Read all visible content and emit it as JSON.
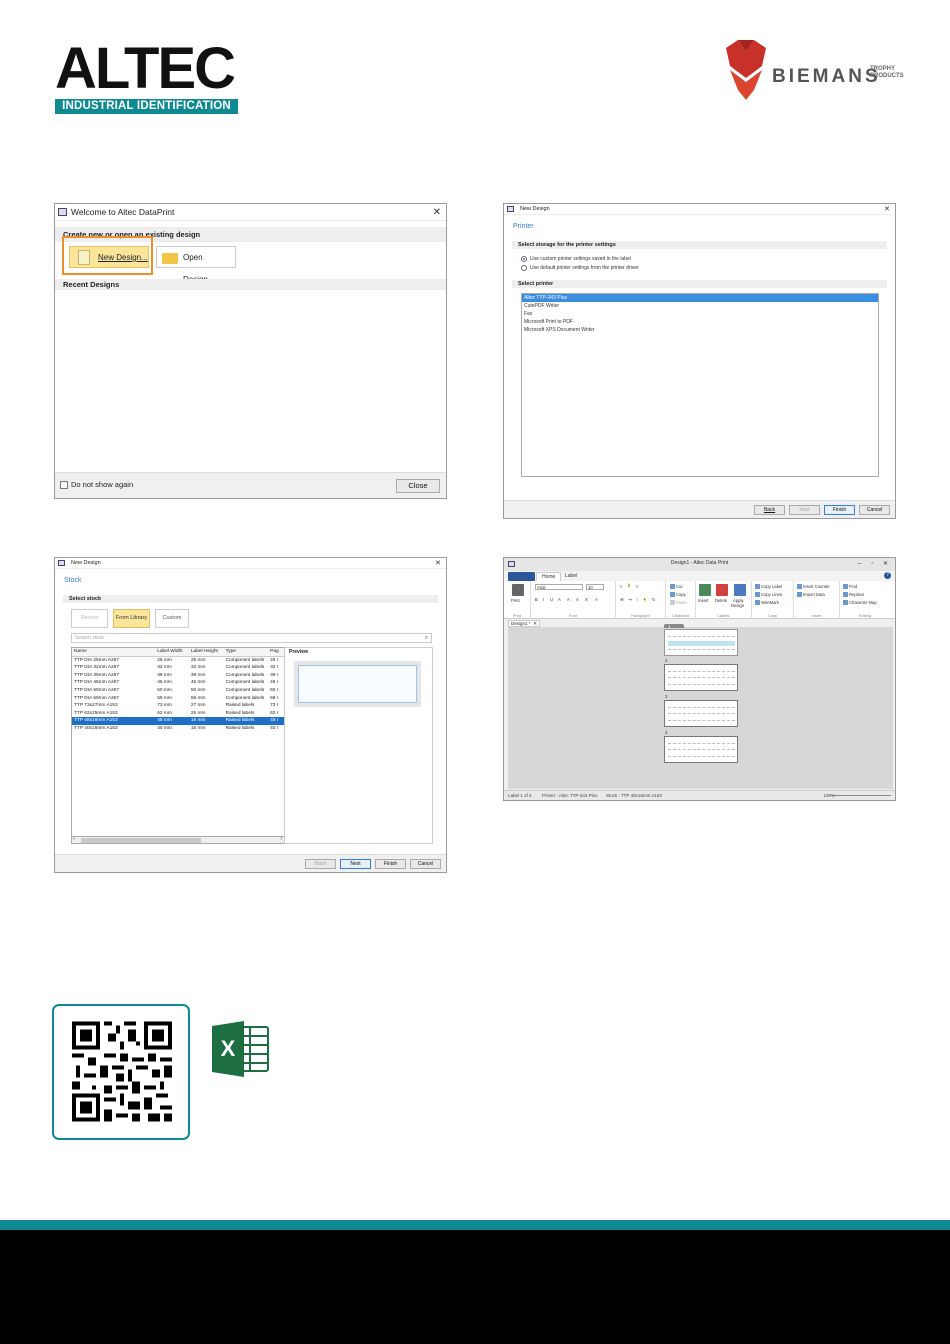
{
  "brand": {
    "altec": "ALTEC",
    "altec_tagline": "INDUSTRIAL IDENTIFICATION",
    "biemans": "BIEMANS",
    "biemans_sub": [
      "TROPHY",
      "PRODUCTS"
    ],
    "teal": "#0f8a92",
    "red": "#c8302a"
  },
  "welcome": {
    "title": "Welcome to Altec DataPrint",
    "section_create": "Create new or open an existing design",
    "new_design": "New Design...",
    "open_design": "Open Design...",
    "section_recent": "Recent Designs",
    "dont_show": "Do not show again",
    "close": "Close"
  },
  "printer": {
    "window_title": "New Design",
    "heading": "Printer",
    "section_storage": "Select storage for the printer settings",
    "option_custom": "Use custom printer settings saved in the label",
    "option_default": "Use default printer settings from the printer driver",
    "section_printer": "Select printer",
    "printers": [
      "Altec TTP-343 Plus",
      "CutePDF Writer",
      "Fax",
      "Microsoft Print to PDF",
      "Microsoft XPS Document Writer"
    ],
    "buttons": {
      "back": "Back",
      "next": "Next",
      "finish": "Finish",
      "cancel": "Cancel"
    }
  },
  "stock": {
    "window_title": "New Design",
    "heading": "Stock",
    "section": "Select stock",
    "tabs": [
      "Recent",
      "From Library",
      "Custom"
    ],
    "search_placeholder": "Search stock",
    "columns": [
      "Name",
      "Label Width",
      "Label Height",
      "Type",
      "Pag"
    ],
    "rows": [
      [
        "TTP DIA 25mm A267",
        "25 mm",
        "25 mm",
        "Component labels",
        "25 r"
      ],
      [
        "TTP DIA 32mm A267",
        "32 mm",
        "32 mm",
        "Component labels",
        "32 r"
      ],
      [
        "TTP DIA 39mm A267",
        "39 mm",
        "39 mm",
        "Component labels",
        "39 r"
      ],
      [
        "TTP DIA 45mm A267",
        "45 mm",
        "45 mm",
        "Component labels",
        "45 r"
      ],
      [
        "TTP DIA 50mm A267",
        "50 mm",
        "50 mm",
        "Component labels",
        "50 r"
      ],
      [
        "TTP DIA 59mm A267",
        "59 mm",
        "59 mm",
        "Component labels",
        "59 r"
      ],
      [
        "TTP 73x27mm A153",
        "73 mm",
        "27 mm",
        "Raised labels",
        "73 r"
      ],
      [
        "TTP 62x25mm A153",
        "62 mm",
        "25 mm",
        "Raised labels",
        "62 r"
      ],
      [
        "TTP 48x18mm A153",
        "48 mm",
        "18 mm",
        "Raised labels",
        "48 r"
      ],
      [
        "TTP 40x15mm A153",
        "40 mm",
        "15 mm",
        "Raised labels",
        "40 r"
      ]
    ],
    "selected_row": 8,
    "preview": "Preview",
    "buttons": {
      "back": "Back",
      "next": "Next",
      "finish": "Finish",
      "cancel": "Cancel"
    }
  },
  "editor": {
    "title": "Design1 - Altec Data Print",
    "tabs": [
      "Home",
      "Label"
    ],
    "doc_tab": "Design1 *",
    "font": "Arial",
    "font_size": "10",
    "groups": {
      "print": "Print",
      "font": "Font",
      "paragraph": "Paragraph",
      "clipboard": "Clipboard",
      "labels": "Labels",
      "copy": "Copy",
      "insert": "Insert",
      "editing": "Editing"
    },
    "commands": {
      "print": "Print",
      "cut": "Cut",
      "copy": "Copy",
      "paste": "Paste",
      "insert": "Insert",
      "delete": "Delete",
      "apply": "Apply",
      "design": "Design",
      "copy_label": "Copy Label",
      "copy_lines": "Copy Lines",
      "wiremark": "WireMark",
      "insert_counter": "Insert Counter",
      "import_data": "Import Data",
      "find": "Find",
      "replace": "Replace",
      "character_map": "Character Map"
    },
    "labels": [
      "1",
      "2",
      "3",
      "4"
    ],
    "status": {
      "label": "Label 1 of 4",
      "printer": "Printer : Altec TTP-343 Plus",
      "stock": "Stock : TTP 48x18mm A153",
      "zoom": "100%"
    }
  }
}
